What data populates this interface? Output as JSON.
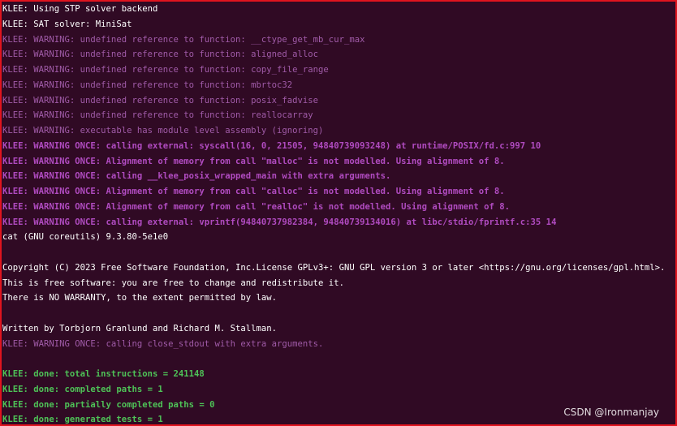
{
  "terminal": {
    "colors": {
      "background": "#300a24",
      "border": "#e0141e",
      "plain": "#ffffff",
      "warning": "#a05ba8",
      "warning_once": "#b04bc0",
      "done": "#4ec257"
    },
    "lines": [
      {
        "text": "KLEE: Using STP solver backend",
        "kind": "plain"
      },
      {
        "text": "KLEE: SAT solver: MiniSat",
        "kind": "plain"
      },
      {
        "text": "KLEE: WARNING: undefined reference to function: __ctype_get_mb_cur_max",
        "kind": "warn"
      },
      {
        "text": "KLEE: WARNING: undefined reference to function: aligned_alloc",
        "kind": "warn"
      },
      {
        "text": "KLEE: WARNING: undefined reference to function: copy_file_range",
        "kind": "warn"
      },
      {
        "text": "KLEE: WARNING: undefined reference to function: mbrtoc32",
        "kind": "warn"
      },
      {
        "text": "KLEE: WARNING: undefined reference to function: posix_fadvise",
        "kind": "warn"
      },
      {
        "text": "KLEE: WARNING: undefined reference to function: reallocarray",
        "kind": "warn"
      },
      {
        "text": "KLEE: WARNING: executable has module level assembly (ignoring)",
        "kind": "warn"
      },
      {
        "text": "KLEE: WARNING ONCE: calling external: syscall(16, 0, 21505, 94840739093248) at runtime/POSIX/fd.c:997 10",
        "kind": "once"
      },
      {
        "text": "KLEE: WARNING ONCE: Alignment of memory from call \"malloc\" is not modelled. Using alignment of 8.",
        "kind": "once"
      },
      {
        "text": "KLEE: WARNING ONCE: calling __klee_posix_wrapped_main with extra arguments.",
        "kind": "once"
      },
      {
        "text": "KLEE: WARNING ONCE: Alignment of memory from call \"calloc\" is not modelled. Using alignment of 8.",
        "kind": "once"
      },
      {
        "text": "KLEE: WARNING ONCE: Alignment of memory from call \"realloc\" is not modelled. Using alignment of 8.",
        "kind": "once"
      },
      {
        "text": "KLEE: WARNING ONCE: calling external: vprintf(94840737982384, 94840739134016) at libc/stdio/fprintf.c:35 14",
        "kind": "once"
      },
      {
        "text": "cat (GNU coreutils) 9.3.80-5e1e0",
        "kind": "plain"
      },
      {
        "text": "",
        "kind": "plain"
      },
      {
        "text": "Copyright (C) 2023 Free Software Foundation, Inc.License GPLv3+: GNU GPL version 3 or later <https://gnu.org/licenses/gpl.html>.",
        "kind": "plain"
      },
      {
        "text": "This is free software: you are free to change and redistribute it.",
        "kind": "plain"
      },
      {
        "text": "There is NO WARRANTY, to the extent permitted by law.",
        "kind": "plain"
      },
      {
        "text": "",
        "kind": "plain"
      },
      {
        "text": "Written by Torbjorn Granlund and Richard M. Stallman.",
        "kind": "plain"
      },
      {
        "text": "KLEE: WARNING ONCE: calling close_stdout with extra arguments.",
        "kind": "warn"
      },
      {
        "text": "",
        "kind": "plain"
      },
      {
        "text": "KLEE: done: total instructions = 241148",
        "kind": "done"
      },
      {
        "text": "KLEE: done: completed paths = 1",
        "kind": "done"
      },
      {
        "text": "KLEE: done: partially completed paths = 0",
        "kind": "done"
      },
      {
        "text": "KLEE: done: generated tests = 1",
        "kind": "done"
      }
    ]
  },
  "watermark": {
    "text": "CSDN @Ironmanjay"
  }
}
